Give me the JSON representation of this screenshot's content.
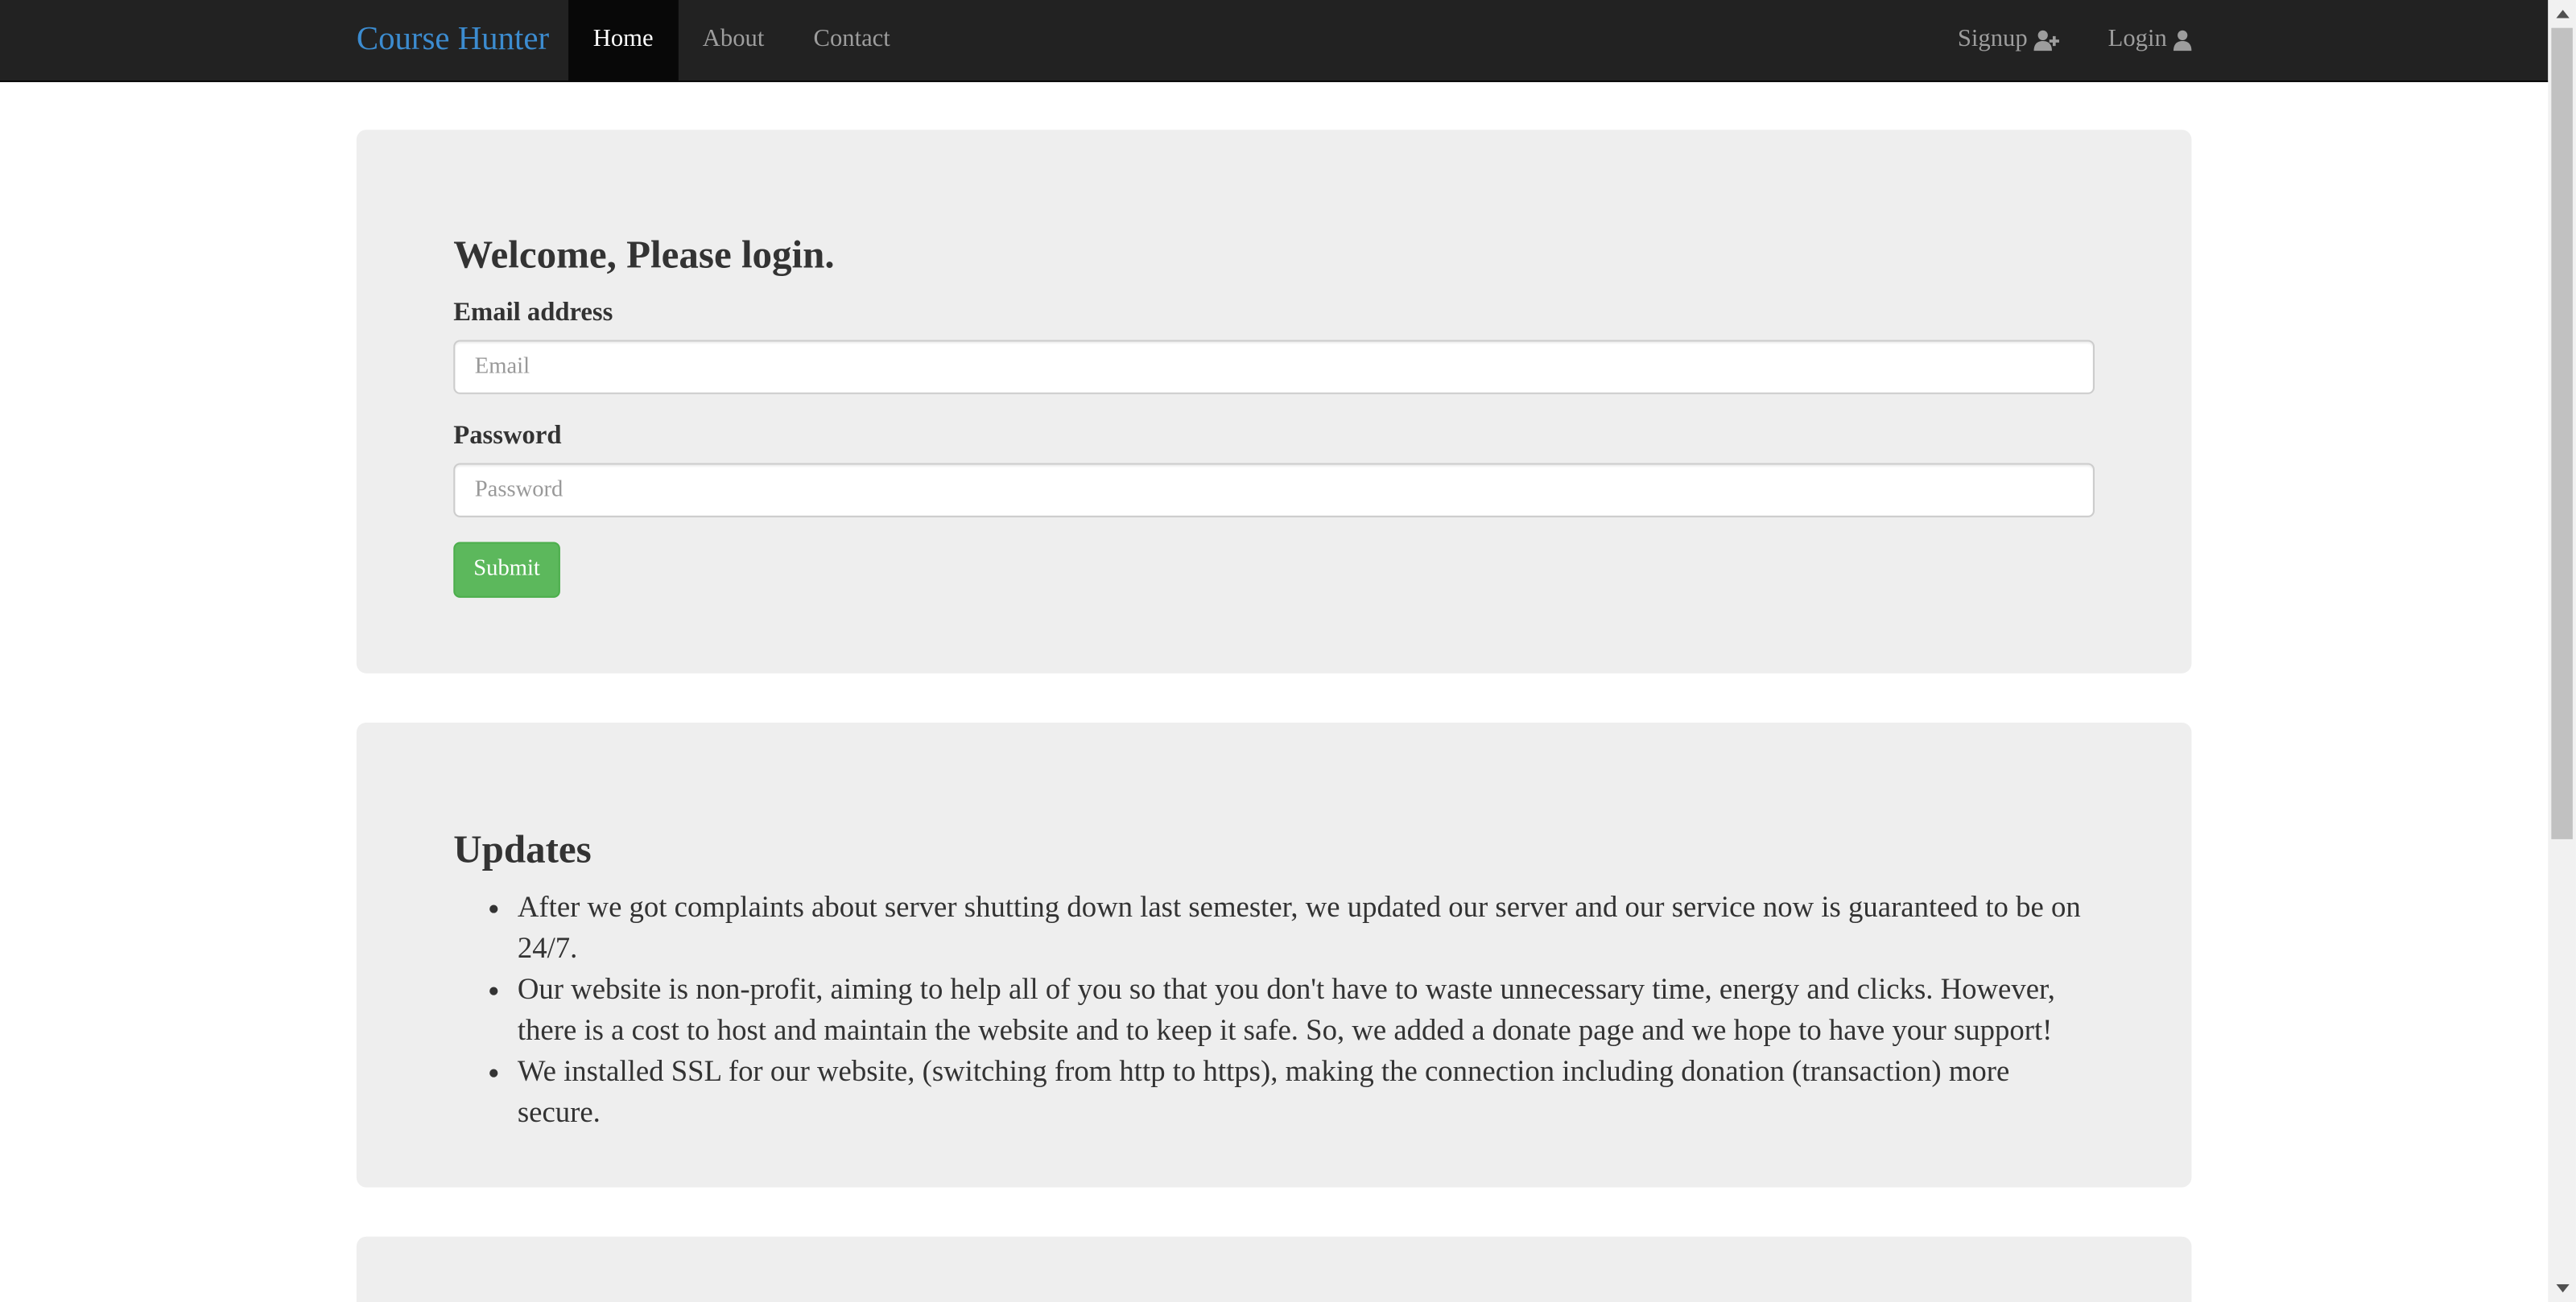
{
  "navbar": {
    "brand": "Course Hunter",
    "brand_color": "#3c8cd0",
    "items": [
      {
        "label": "Home",
        "active": true
      },
      {
        "label": "About",
        "active": false
      },
      {
        "label": "Contact",
        "active": false
      }
    ],
    "right_items": [
      {
        "label": "Signup",
        "icon": "user-plus-icon"
      },
      {
        "label": "Login",
        "icon": "user-icon"
      }
    ]
  },
  "login": {
    "title": "Welcome, Please login.",
    "email_label": "Email address",
    "email_placeholder": "Email",
    "email_value": "",
    "password_label": "Password",
    "password_placeholder": "Password",
    "password_value": "",
    "submit_label": "Submit",
    "submit_color": "#5cb85c"
  },
  "updates": {
    "title": "Updates",
    "items": [
      "After we got complaints about server shutting down last semester, we updated our server and our service now is guaranteed to be on 24/7.",
      "Our website is non-profit, aiming to help all of you so that you don't have to waste unnecessary time, energy and clicks. However, there is a cost to host and maintain the website and to keep it safe. So, we added a donate page and we hope to have your support!",
      "We installed SSL for our website, (switching from http to https), making the connection including donation (transaction) more secure."
    ]
  },
  "colors": {
    "navbar_bg": "#222222",
    "panel_bg": "#eeeeee"
  }
}
